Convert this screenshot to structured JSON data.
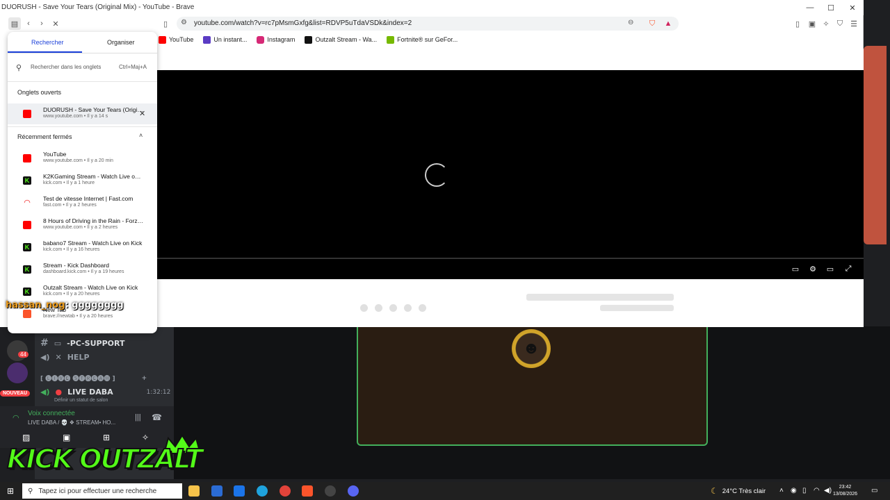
{
  "window": {
    "title": "DUORUSH - Save Your Tears (Original Mix) - YouTube - Brave",
    "url": "youtube.com/watch?v=rc7pMsmGxfg&list=RDVP5uTdaVSDk&index=2"
  },
  "bookmarks": [
    {
      "label": "YouTube",
      "color": "#ff0000"
    },
    {
      "label": "Un instant...",
      "color": "#5b3cc4"
    },
    {
      "label": "Instagram",
      "color": "#d62976"
    },
    {
      "label": "Outzalt Stream - Wa...",
      "color": "#53fc18"
    },
    {
      "label": "Fortnite® sur GeFor...",
      "color": "#76b900"
    }
  ],
  "tab_panel": {
    "tabs": [
      "Rechercher",
      "Organiser"
    ],
    "search_placeholder": "Rechercher dans les onglets",
    "search_shortcut": "Ctrl+Maj+A",
    "open_section": "Onglets ouverts",
    "open_tabs": [
      {
        "title": "DUORUSH - Save Your Tears (Original Mix) - YouTube",
        "meta": "www.youtube.com • Il y a 14 s",
        "favicon": "youtube"
      }
    ],
    "closed_section": "Récemment fermés",
    "closed_tabs": [
      {
        "title": "YouTube",
        "meta": "www.youtube.com • Il y a 20 min",
        "favicon": "youtube"
      },
      {
        "title": "K2KGaming Stream - Watch Live on Kick",
        "meta": "kick.com • Il y a 1 heure",
        "favicon": "kick"
      },
      {
        "title": "Test de vitesse Internet | Fast.com",
        "meta": "fast.com • Il y a 2 heures",
        "favicon": "fast"
      },
      {
        "title": "8 Hours of Driving in the Rain - Forza Horizon",
        "meta": "www.youtube.com • Il y a 2 heures",
        "favicon": "youtube"
      },
      {
        "title": "babano7 Stream - Watch Live on Kick",
        "meta": "kick.com • Il y a 16 heures",
        "favicon": "kick"
      },
      {
        "title": "Stream - Kick Dashboard",
        "meta": "dashboard.kick.com • Il y a 19 heures",
        "favicon": "kick"
      },
      {
        "title": "Outzalt Stream - Watch Live on Kick",
        "meta": "kick.com • Il y a 20 heures",
        "favicon": "kick"
      },
      {
        "title": "New Tab",
        "meta": "brave://newtab • Il y a 20 heures",
        "favicon": "brave"
      }
    ]
  },
  "overlay": {
    "chat_nick": "hassan_nog",
    "chat_message": ": gggggggg"
  },
  "discord": {
    "channel_1": "-PC-SUPPORT",
    "channel_2": "HELP",
    "category": "[ 🅛🅘🅥🅔 🅢🅣🅡🅔🅐🅜 ]",
    "voice_channel": "LIVE DABA",
    "voice_timer": "1:32:12",
    "voice_status_hint": "Définir un statut de salon",
    "badge_new": "NOUVEAU",
    "badge_count": "44",
    "connected_label": "Voix connectée",
    "connected_detail": "LIVE DABA / 💀 ❖ STREAM• HO..."
  },
  "kick_logo": "KICK OUTZALT",
  "taskbar": {
    "search_placeholder": "Tapez ici pour effectuer une recherche",
    "weather": "24°C  Très clair",
    "time": "23:42",
    "date": "13/08/2026"
  }
}
